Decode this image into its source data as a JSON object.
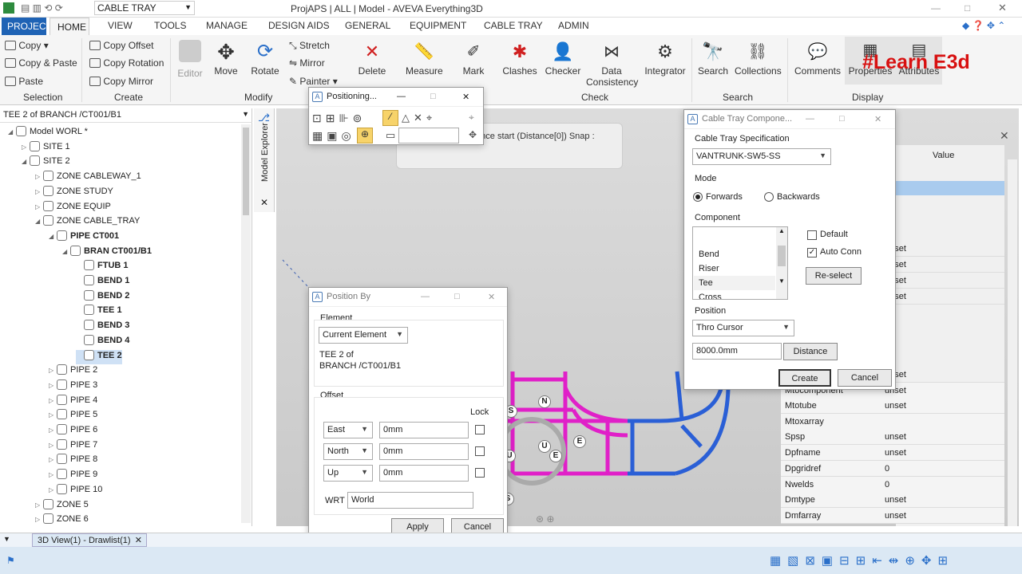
{
  "window": {
    "title": "ProjAPS | ALL | Model - AVEVA Everything3D",
    "quick_combo": "CABLE TRAY"
  },
  "menu": {
    "tabs": [
      "PROJECT",
      "HOME",
      "VIEW",
      "TOOLS",
      "MANAGE",
      "DESIGN AIDS",
      "GENERAL",
      "EQUIPMENT",
      "CABLE TRAY",
      "ADMIN"
    ]
  },
  "ribbon": {
    "selection": {
      "copy": "Copy",
      "copy_paste": "Copy & Paste",
      "paste": "Paste",
      "group": "Selection"
    },
    "create": {
      "copy_offset": "Copy Offset",
      "copy_rotation": "Copy Rotation",
      "copy_mirror": "Copy Mirror",
      "group": "Create"
    },
    "modify": {
      "editor": "Editor",
      "move": "Move",
      "rotate": "Rotate",
      "stretch": "Stretch",
      "mirror": "Mirror",
      "painter": "Painter",
      "group": "Modify"
    },
    "check": {
      "delete": "Delete",
      "measure": "Measure",
      "mark": "Mark",
      "clashes": "Clashes",
      "checker": "Checker",
      "data_consistency_1": "Data",
      "data_consistency_2": "Consistency",
      "integrator": "Integrator",
      "group": "Check"
    },
    "search": {
      "search": "Search",
      "collections": "Collections",
      "group": "Search"
    },
    "display": {
      "comments": "Comments",
      "properties": "Properties",
      "attributes": "Attributes",
      "group": "Display"
    },
    "watermark": "#Learn E3d"
  },
  "tree": {
    "header": "TEE 2 of BRANCH /CT001/B1",
    "explorer_label": "Model Explorer",
    "items": [
      "Model WORL *",
      "SITE 1",
      "SITE 2",
      "ZONE CABLEWAY_1",
      "ZONE STUDY",
      "ZONE EQUIP",
      "ZONE CABLE_TRAY",
      "PIPE CT001",
      "BRAN CT001/B1",
      "FTUB 1",
      "BEND 1",
      "BEND 2",
      "TEE 1",
      "BEND 3",
      "BEND 4",
      "TEE 2",
      "PIPE 2",
      "PIPE 3",
      "PIPE 4",
      "PIPE 5",
      "PIPE 6",
      "PIPE 7",
      "PIPE 8",
      "PIPE 9",
      "PIPE 10",
      "ZONE 5",
      "ZONE 6"
    ]
  },
  "positioning": {
    "title": "Positioning...",
    "prompt": "tance start (Distance[0]) Snap :"
  },
  "position_by": {
    "title": "Position By",
    "element_label": "Element",
    "element_value": "Current Element",
    "element_desc_1": "TEE 2 of",
    "element_desc_2": "BRANCH /CT001/B1",
    "offset_label": "Offset",
    "lock_label": "Lock",
    "rows": [
      {
        "dir": "East",
        "val": "0mm"
      },
      {
        "dir": "North",
        "val": "0mm"
      },
      {
        "dir": "Up",
        "val": "0mm"
      }
    ],
    "wrt_label": "WRT",
    "wrt_value": "World",
    "apply": "Apply",
    "cancel": "Cancel"
  },
  "cable_tray": {
    "title": "Cable Tray Compone...",
    "spec_label": "Cable Tray Specification",
    "spec_value": "VANTRUNK-SW5-SS",
    "mode_label": "Mode",
    "forwards": "Forwards",
    "backwards": "Backwards",
    "component_label": "Component",
    "components": [
      "Bend",
      "Riser",
      "Tee",
      "Cross"
    ],
    "default": "Default",
    "auto_conn": "Auto Conn",
    "reselect": "Re-select",
    "position_label": "Position",
    "position_value": "Thro Cursor",
    "distance_value": "8000.0mm",
    "distance_btn": "Distance",
    "create": "Create",
    "cancel": "Cancel"
  },
  "attributes": {
    "value_header": "Value",
    "rows": [
      {
        "name": "",
        "value": "unset"
      },
      {
        "name": "",
        "value": "unset"
      },
      {
        "name": "",
        "value": "unset"
      },
      {
        "name": "",
        "value": "unset"
      },
      {
        "name": "",
        "value": "unset"
      },
      {
        "name": "Mtocomponent",
        "value": "unset"
      },
      {
        "name": "Mtotube",
        "value": "unset"
      },
      {
        "name": "Mtoxarray",
        "value": ""
      },
      {
        "name": "Spsp",
        "value": "unset"
      },
      {
        "name": "Dpfname",
        "value": "unset"
      },
      {
        "name": "Dpgridref",
        "value": "0"
      },
      {
        "name": "Nwelds",
        "value": "0"
      },
      {
        "name": "Dmtype",
        "value": "unset"
      },
      {
        "name": "Dmfarray",
        "value": "unset"
      }
    ]
  },
  "doc_tab": "3D View(1) - Drawlist(1)",
  "model_labels": [
    "N",
    "U",
    "E",
    "E",
    "U",
    "S",
    "S"
  ],
  "colors": {
    "accent": "#1f63b5",
    "magenta": "#e020c8",
    "blue": "#2a5fd6"
  }
}
